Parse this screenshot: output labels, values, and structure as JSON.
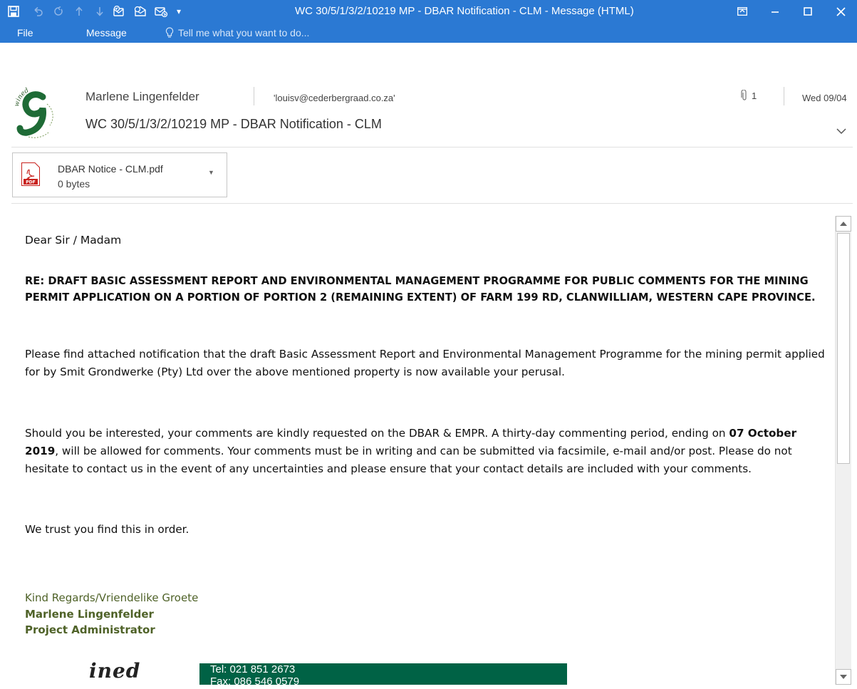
{
  "window": {
    "title": "WC 30/5/1/3/2/10219 MP - DBAR Notification - CLM - Message (HTML)",
    "accent": "#2B79D3"
  },
  "quick_access": {
    "icons": [
      "save-icon",
      "undo-icon",
      "redo-icon",
      "up-icon",
      "down-icon",
      "reply-icon",
      "reply-all-icon",
      "forward-icon",
      "customize-icon"
    ]
  },
  "ribbon": {
    "tabs": [
      "File",
      "Message"
    ],
    "tell_me": "Tell me what you want to do..."
  },
  "message": {
    "sender": "Marlene Lingenfelder",
    "to": "'louisv@cederbergraad.co.za'",
    "subject": "WC 30/5/1/3/2/10219 MP - DBAR Notification - CLM",
    "attachment_count": "1",
    "date": "Wed 09/04"
  },
  "attachment": {
    "name": "DBAR Notice - CLM.pdf",
    "size": "0 bytes"
  },
  "body": {
    "greeting": "Dear Sir / Madam",
    "re": "RE: DRAFT BASIC ASSESSMENT REPORT AND ENVIRONMENTAL MANAGEMENT PROGRAMME FOR PUBLIC COMMENTS FOR THE MINING PERMIT APPLICATION ON A PORTION OF PORTION 2 (REMAINING EXTENT) OF FARM 199 RD, CLANWILLIAM, WESTERN CAPE PROVINCE.",
    "para1": "Please find attached notification that the draft Basic Assessment Report and Environmental Management Programme for the mining permit applied for by Smit Grondwerke (Pty) Ltd over the above mentioned property is now available your perusal.",
    "para2_a": "Should you be interested, your comments are kindly requested on the DBAR & EMPR. A thirty-day commenting period, ending on ",
    "para2_date": "07 October 2019",
    "para2_b": ", will be allowed for comments. Your comments must be in writing and can be submitted via facsimile, e-mail and/or post. Please do not hesitate to contact us in the event of any uncertainties and please ensure that your contact details are included with your comments.",
    "para3": "We trust you find this in order.",
    "sig_regards": "Kind Regards/Vriendelike Groete",
    "sig_name": "Marlene Lingenfelder",
    "sig_title": "Project Administrator",
    "sig_logo_text": "ined",
    "contact_tel": "Tel: 021 851 2673",
    "contact_fax": "Fax: 086 546 0579"
  }
}
